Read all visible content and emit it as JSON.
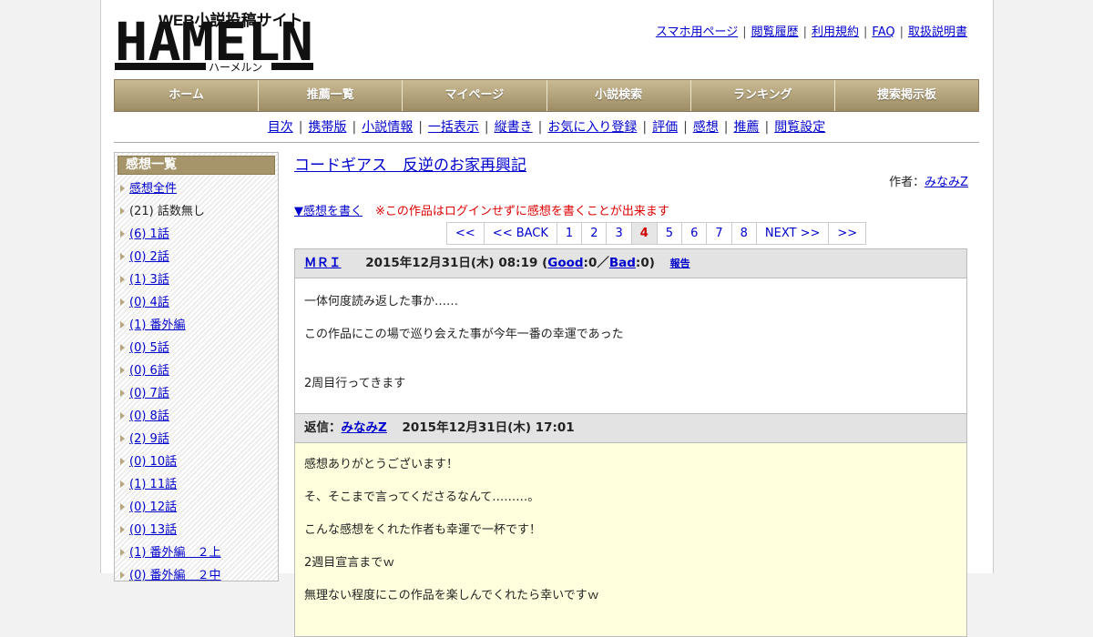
{
  "site": {
    "tagline": "WEB小説投稿サイト",
    "logo_text": "HAMELN",
    "logo_kana": "ハーメルン"
  },
  "top_links": [
    "スマホ用ページ",
    "閲覧履歴",
    "利用規約",
    "FAQ",
    "取扱説明書"
  ],
  "global_nav": [
    "ホーム",
    "推薦一覧",
    "マイページ",
    "小説検索",
    "ランキング",
    "捜索掲示板"
  ],
  "sub_nav": [
    "目次",
    "携帯版",
    "小説情報",
    "一括表示",
    "縦書き",
    "お気に入り登録",
    "評価",
    "感想",
    "推薦",
    "閲覧設定"
  ],
  "sidebar": {
    "heading": "感想一覧",
    "items": [
      {
        "label": "感想全件",
        "link": true
      },
      {
        "label": "(21) 話数無し",
        "link": false
      },
      {
        "label": "(6) 1話",
        "link": true
      },
      {
        "label": "(0) 2話",
        "link": true
      },
      {
        "label": "(1) 3話",
        "link": true
      },
      {
        "label": "(0) 4話",
        "link": true
      },
      {
        "label": "(1) 番外編",
        "link": true
      },
      {
        "label": "(0) 5話",
        "link": true
      },
      {
        "label": "(0) 6話",
        "link": true
      },
      {
        "label": "(0) 7話",
        "link": true
      },
      {
        "label": "(0) 8話",
        "link": true
      },
      {
        "label": "(2) 9話",
        "link": true
      },
      {
        "label": "(0) 10話",
        "link": true
      },
      {
        "label": "(1) 11話",
        "link": true
      },
      {
        "label": "(0) 12話",
        "link": true
      },
      {
        "label": "(0) 13話",
        "link": true
      },
      {
        "label": "(1) 番外編　２上",
        "link": true
      },
      {
        "label": "(0) 番外編　２中",
        "link": true
      }
    ]
  },
  "novel": {
    "title": "コードギアス　反逆のお家再興記",
    "author_prefix": "作者：",
    "author": "みなみZ"
  },
  "write_link": "▼感想を書く",
  "login_notice": "※この作品はログインせずに感想を書くことが出来ます",
  "pager": [
    {
      "label": "<<",
      "current": false
    },
    {
      "label": "<< BACK",
      "current": false
    },
    {
      "label": "1",
      "current": false
    },
    {
      "label": "2",
      "current": false
    },
    {
      "label": "3",
      "current": false
    },
    {
      "label": "4",
      "current": true
    },
    {
      "label": "5",
      "current": false
    },
    {
      "label": "6",
      "current": false
    },
    {
      "label": "7",
      "current": false
    },
    {
      "label": "8",
      "current": false
    },
    {
      "label": "NEXT >>",
      "current": false
    },
    {
      "label": ">>",
      "current": false
    }
  ],
  "comment": {
    "user": "ＭＲＩ",
    "date": "2015年12月31日(木) 08:19",
    "good_label": "Good",
    "good_count": ":0／",
    "bad_label": "Bad",
    "bad_count": ":0)",
    "open_paren": "(",
    "report": "報告",
    "body": [
      "一体何度読み返した事か……",
      "この作品にこの場で巡り会えた事が今年一番の幸運であった",
      "",
      "2周目行ってきます"
    ]
  },
  "reply": {
    "prefix": "返信：",
    "author": "みなみZ",
    "date": "2015年12月31日(木) 17:01",
    "body": [
      "感想ありがとうございます！",
      "そ、そこまで言ってくださるなんて………。",
      "こんな感想をくれた作者も幸運で一杯です！",
      "2週目宣言までｗ",
      "無理ない程度にこの作品を楽しんでくれたら幸いですｗ"
    ]
  }
}
